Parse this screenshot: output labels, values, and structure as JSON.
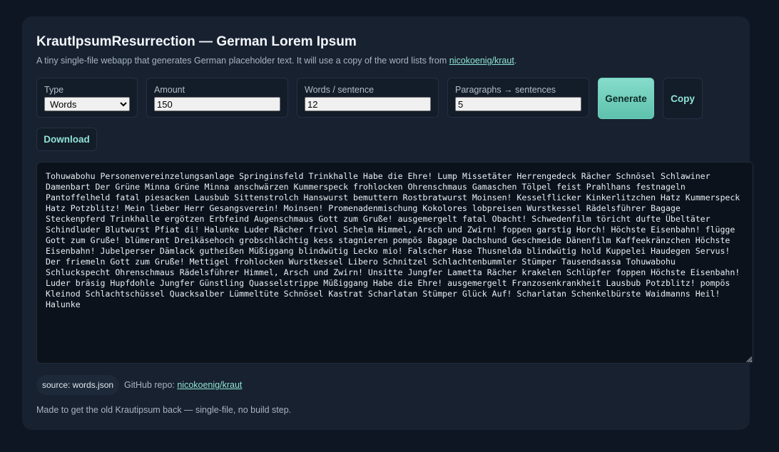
{
  "header": {
    "title": "KrautIpsumResurrection — German Lorem Ipsum",
    "subtitle_prefix": "A tiny single-file webapp that generates German placeholder text. It will use a copy of the word lists from ",
    "subtitle_link": "nicokoenig/kraut",
    "subtitle_suffix": "."
  },
  "controls": {
    "type": {
      "label": "Type",
      "selected": "Words"
    },
    "amount": {
      "label": "Amount",
      "value": "150"
    },
    "words_per_sentence": {
      "label": "Words / sentence",
      "value": "12"
    },
    "paragraphs": {
      "label": "Paragraphs → sentences",
      "value": "5"
    },
    "generate_label": "Generate",
    "copy_label": "Copy",
    "download_label": "Download"
  },
  "output": {
    "text": "Tohuwabohu Personenvereinzelungsanlage Springinsfeld Trinkhalle Habe die Ehre! Lump Missetäter Herrengedeck Rächer Schnösel Schlawiner Damenbart Der Grüne Minna Grüne Minna anschwärzen Kummerspeck frohlocken Ohrenschmaus Gamaschen Tölpel feist Prahlhans festnageln Pantoffelheld fatal piesacken Lausbub Sittenstrolch Hanswurst bemuttern Rostbratwurst Moinsen! Kesselflicker Kinkerlitzchen Hatz Kummerspeck Hatz Potzblitz! Mein lieber Herr Gesangsverein! Moinsen! Promenadenmischung Kokolores lobpreisen Wurstkessel Rädelsführer Bagage Steckenpferd Trinkhalle ergötzen Erbfeind Augenschmaus Gott zum Gruße! ausgemergelt fatal Obacht! Schwedenfilm töricht dufte Übeltäter Schindluder Blutwurst Pfiat di! Halunke Luder Rächer frivol Schelm Himmel, Arsch und Zwirn! foppen garstig Horch! Höchste Eisenbahn! flügge Gott zum Gruße! blümerant Dreikäsehoch grobschlächtig kess stagnieren pompös Bagage Dachshund Geschmeide Dänenfilm Kaffeekränzchen Höchste Eisenbahn! Jubelperser Dämlack gutheißen Müßiggang blindwütig Lecko mio! Falscher Hase Thusnelda blindwütig hold Kuppelei Haudegen Servus! Der friemeln Gott zum Gruße! Mettigel frohlocken Wurstkessel Libero Schnitzel Schlachtenbummler Stümper Tausendsassa Tohuwabohu Schluckspecht Ohrenschmaus Rädelsführer Himmel, Arsch und Zwirn! Unsitte Jungfer Lametta Rächer krakelen Schlüpfer foppen Höchste Eisenbahn! Luder bräsig Hupfdohle Jungfer Günstling Quasselstrippe Müßiggang Habe die Ehre! ausgemergelt Franzosenkrankheit Lausbub Potzblitz! pompös Kleinod Schlachtschüssel Quacksalber Lümmeltüte Schnösel Kastrat Scharlatan Stümper Glück Auf! Scharlatan Schenkelbürste Waidmanns Heil! Halunke"
  },
  "meta": {
    "source_badge": "source: words.json",
    "repo_label": "GitHub repo: ",
    "repo_link": "nicokoenig/kraut",
    "footer": "Made to get the old Krautipsum back — single-file, no build step."
  },
  "colors": {
    "background": "#0e1624",
    "card": "#172130",
    "accent": "#6fd0bc",
    "link": "#8fe3d3"
  }
}
